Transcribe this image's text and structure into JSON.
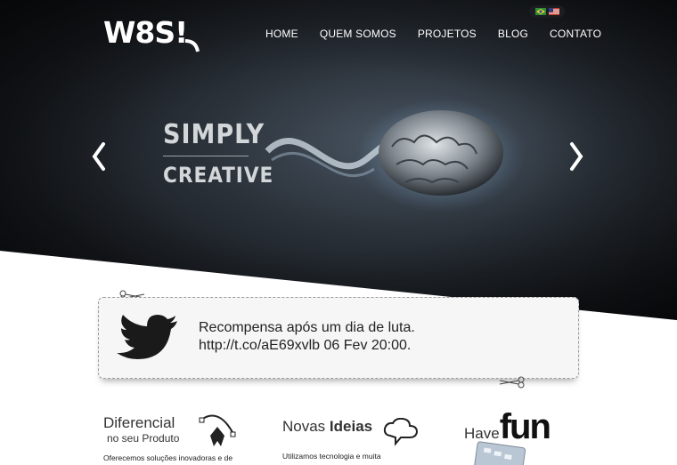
{
  "header": {
    "logo_text": "W8S!",
    "nav": [
      "HOME",
      "QUEM SOMOS",
      "PROJETOS",
      "BLOG",
      "CONTATO"
    ],
    "languages": [
      "pt-BR",
      "en-US"
    ]
  },
  "hero": {
    "line1": "SIMPLY",
    "line2": "CREATIVE",
    "prev_icon": "chevron-left-icon",
    "next_icon": "chevron-right-icon"
  },
  "tweet": {
    "line1": "Recompensa após um dia de luta.",
    "line2": "http://t.co/aE69xvlb 06 Fev 20:00."
  },
  "features": [
    {
      "title": "Diferencial",
      "subtitle": "no seu Produto",
      "text": "Oferecemos soluções inovadoras e de"
    },
    {
      "title_plain": "Novas ",
      "title_bold": "Ideias",
      "text": "Utilizamos tecnologia e muita"
    },
    {
      "title_plain": "Have",
      "title_big": "fun"
    }
  ]
}
